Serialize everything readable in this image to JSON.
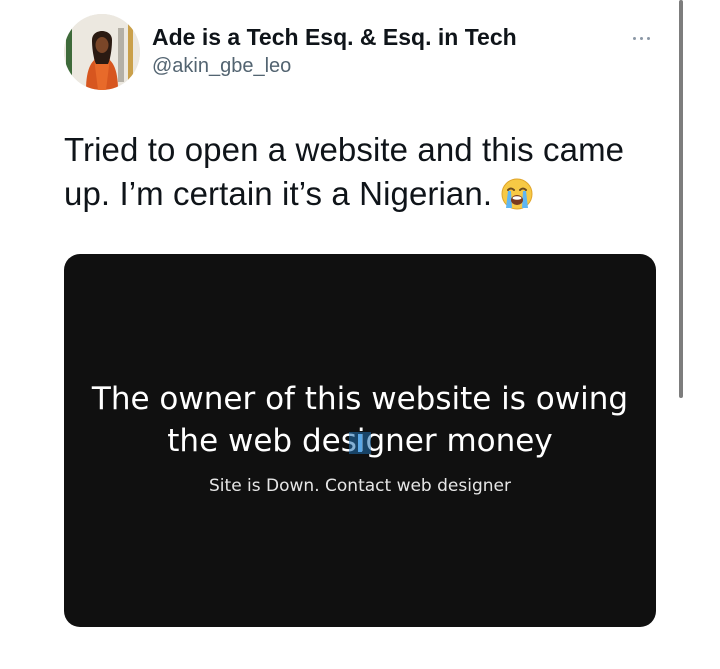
{
  "author": {
    "display_name": "Ade is a Tech Esq. & Esq. in Tech",
    "handle": "@akin_gbe_leo",
    "avatar_icon": "profile-photo"
  },
  "tweet": {
    "text": "Tried to open a website and this came up. I’m certain it’s a Nigerian.",
    "emoji": "loudly-crying-face-icon"
  },
  "media": {
    "headline": "The owner of this website is owing the web designer money",
    "subtext": "Site is Down. Contact web designer",
    "background": "#101010"
  },
  "colors": {
    "text_primary": "#0f1419",
    "text_secondary": "#536471",
    "more_dots": "#8b98a5",
    "scrollbar": "#7d7d7d"
  }
}
